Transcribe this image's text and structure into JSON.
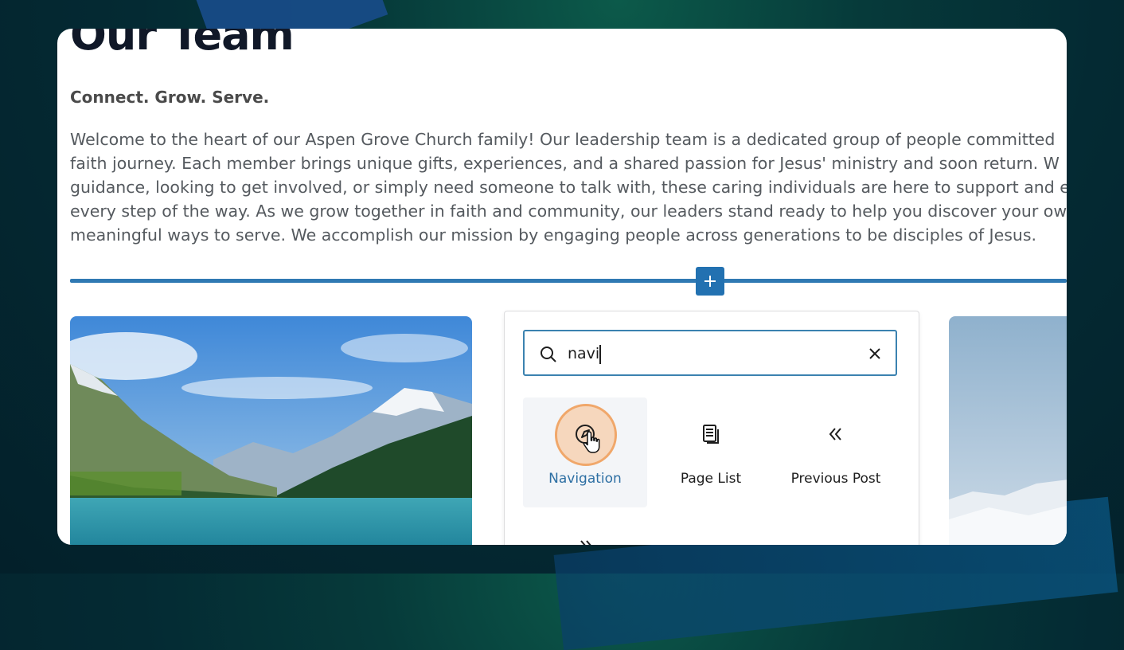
{
  "page": {
    "heading": "Our Team",
    "subheading": "Connect. Grow. Serve.",
    "paragraph": "Welcome to the heart of our Aspen Grove Church family! Our leadership team is a dedicated group of people committed\nfaith journey. Each member brings unique gifts, experiences, and a shared passion for Jesus' ministry and soon return. W\nguidance, looking to get involved, or simply need someone to talk with, these caring individuals are here to support and e\nevery step of the way. As we grow together in faith and community, our leaders stand ready to help you discover your ow\nmeaningful ways to serve. We accomplish our mission by engaging people across generations to be disciples of Jesus."
  },
  "inserter": {
    "search_value": "navi",
    "search_icon": "search-icon",
    "clear_icon": "close-icon",
    "add_block_icon": "plus-icon",
    "blocks": [
      {
        "label": "Navigation",
        "icon": "navigation-compass-icon",
        "selected": true
      },
      {
        "label": "Page List",
        "icon": "page-list-icon",
        "selected": false
      },
      {
        "label": "Previous Post",
        "icon": "double-chevron-left-icon",
        "selected": false
      }
    ],
    "next_block_icon": "double-chevron-right-icon"
  },
  "colors": {
    "accent": "#2271b1",
    "separator": "#2f79b3",
    "selected_label": "#2d6fa3",
    "highlight": "#f0a76a"
  }
}
